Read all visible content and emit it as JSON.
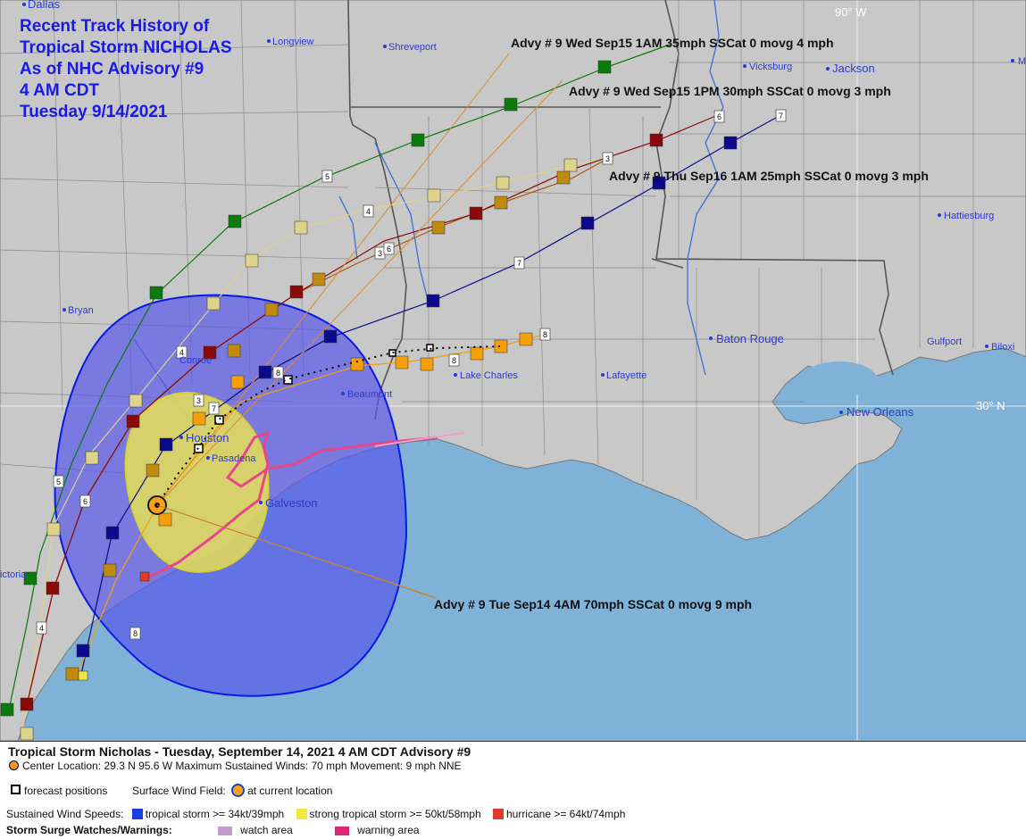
{
  "map": {
    "title_lines": [
      "Recent Track History of",
      "Tropical Storm NICHOLAS",
      "As of NHC Advisory #9",
      "4 AM CDT",
      "Tuesday 9/14/2021"
    ],
    "graticule": {
      "lon_label": "90° W",
      "lat_label": "30° N"
    },
    "cities": {
      "dallas": "Dallas",
      "longview": "Longview",
      "shreveport": "Shreveport",
      "vicksburg": "Vicksburg",
      "jackson": "Jackson",
      "m_edge": "M",
      "hattiesburg": "Hattiesburg",
      "bryan": "Bryan",
      "conroe": "Conroe",
      "houston": "Houston",
      "pasadena": "Pasadena",
      "galveston": "Galveston",
      "beaumont": "Beaumont",
      "lake_charles": "Lake Charles",
      "lafayette": "Lafayette",
      "baton_rouge": "Baton Rouge",
      "new_orleans": "New Orleans",
      "gulfport": "Gulfport",
      "biloxi": "Biloxi",
      "victoria": "ictoria"
    },
    "advisory_labels": [
      "Advy # 9 Wed Sep15 1AM  35mph SSCat 0 movg 4 mph",
      "Advy # 9 Wed Sep15 1PM  30mph SSCat 0 movg 3 mph",
      "Advy # 9 Thu Sep16 1AM  25mph SSCat 0 movg 3 mph",
      "Advy # 9 Tue Sep14 4AM  70mph SSCat 0 movg 9 mph"
    ],
    "colors": {
      "land": "#c8c8c8",
      "water": "#7fb2d6",
      "gulf": "#5f9fd0",
      "tropical_storm_field": "#3a3ae0",
      "strong_ts_field": "#f2ea4a",
      "warning": "#e7468a",
      "watch": "#c79ad1",
      "advisory_track_colors": [
        "#0a7a0a",
        "#ddd38a",
        "#c08a10",
        "#8a0a0a",
        "#0a0a8a",
        "#f5a00a"
      ]
    }
  },
  "legend": {
    "title": "Tropical Storm Nicholas  -  Tuesday, September 14, 2021  4 AM CDT   Advisory #9",
    "center_line": "Center Location: 29.3 N  95.6 W   Maximum Sustained Winds: 70 mph  Movement: 9 mph NNE",
    "forecast_positions": "forecast positions",
    "surface_wind_field": "Surface Wind Field:",
    "at_current_location": "at current location",
    "sustained_wind_speeds": "Sustained Wind Speeds:",
    "tropical_storm": "tropical storm >= 34kt/39mph",
    "strong_tropical_storm": "strong tropical storm >= 50kt/58mph",
    "hurricane": "hurricane >= 64kt/74mph",
    "storm_surge": "Storm Surge Watches/Warnings:",
    "watch_area": "watch area",
    "warning_area": "warning area",
    "swatch_colors": {
      "tropical_storm": "#1a3fe0",
      "strong_tropical_storm": "#f2e640",
      "hurricane": "#e03a28",
      "watch": "#c79ad1",
      "warning": "#e0257a"
    }
  }
}
